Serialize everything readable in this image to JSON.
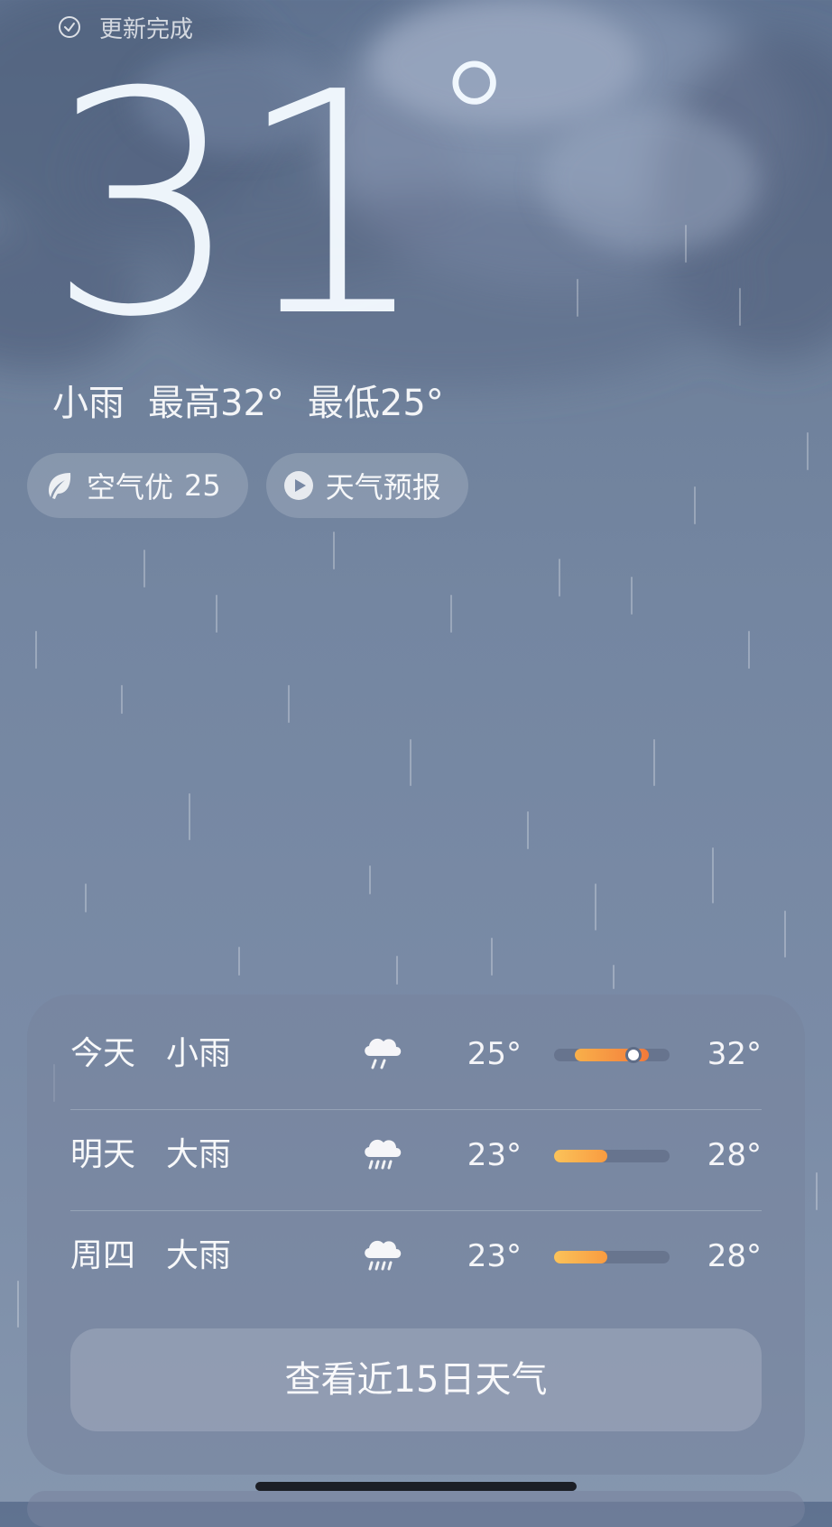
{
  "header": {
    "location_partial": "",
    "update_status": "更新完成"
  },
  "current": {
    "temperature": "31",
    "degree_symbol": "°",
    "condition": "小雨",
    "high": "最高32°",
    "low": "最低25°"
  },
  "chips": {
    "air_quality_label": "空气优",
    "air_quality_value": "25",
    "forecast_video": "天气预报"
  },
  "forecast": {
    "days": [
      {
        "day": "今天",
        "condition": "小雨",
        "icon": "light-rain-icon",
        "low": "25°",
        "high": "32°",
        "bar_start": 0.18,
        "bar_end": 0.82,
        "now_pos": 0.69
      },
      {
        "day": "明天",
        "condition": "大雨",
        "icon": "heavy-rain-icon",
        "low": "23°",
        "high": "28°",
        "bar_start": 0.0,
        "bar_end": 0.46
      },
      {
        "day": "周四",
        "condition": "大雨",
        "icon": "heavy-rain-icon",
        "low": "23°",
        "high": "28°",
        "bar_start": 0.0,
        "bar_end": 0.46
      }
    ],
    "more_label": "查看近15日天气"
  },
  "colors": {
    "bar_warm": "#fbc35a",
    "bar_hot": "#f37a3a",
    "background": "#7486a1"
  }
}
